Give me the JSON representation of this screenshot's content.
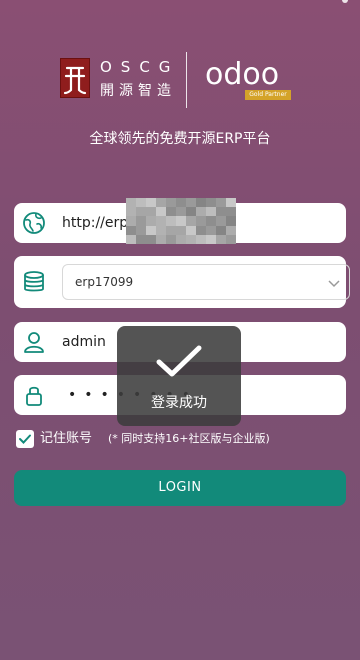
{
  "brand": {
    "oscg_name": "OSCG",
    "oscg_cn": "開源智造",
    "odoo_word": "odoo",
    "badge": "Gold Partner",
    "tagline": "全球领先的免费开源ERP平台"
  },
  "form": {
    "url_value": "http://erp",
    "database_value": "erp17099",
    "username_value": "admin",
    "password_mask": "••••••••",
    "remember_label": "记住账号",
    "remember_note": "(* 同时支持16+社区版与企业版)",
    "remember_checked": true,
    "login_label": "LOGIN"
  },
  "toast": {
    "message": "登录成功"
  },
  "colors": {
    "background": "#7d4e71",
    "accent": "#128a7a",
    "oscg_red": "#8f1d1d",
    "gold": "#d4a329"
  },
  "icons": {
    "url": "globe-icon",
    "database": "database-icon",
    "user": "user-icon",
    "password": "lock-icon",
    "select": "chevron-down-icon",
    "remember": "checkmark-icon",
    "toast": "checkmark-icon"
  }
}
